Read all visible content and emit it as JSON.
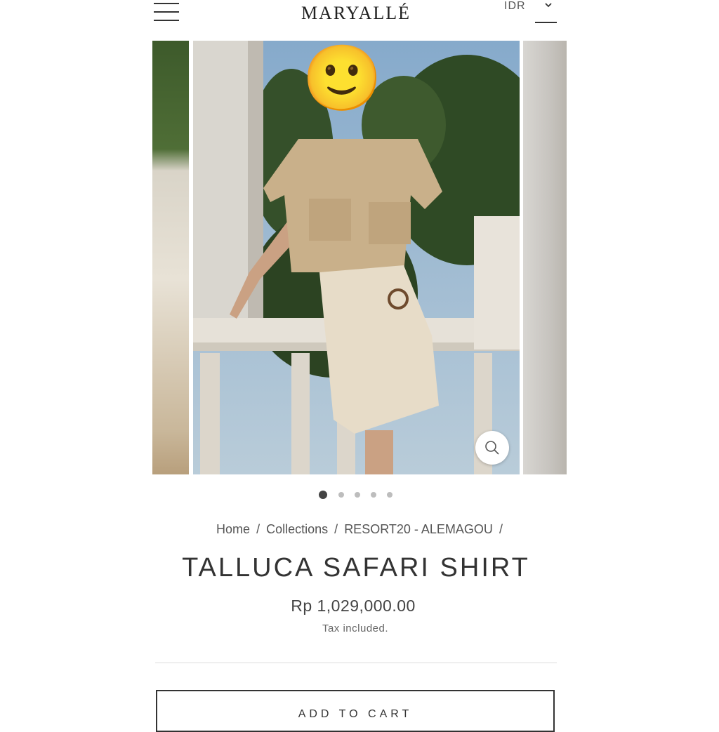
{
  "header": {
    "menu_icon": "hamburger-menu-icon",
    "logo_text": "MARYALLÉ",
    "currency": "IDR",
    "currency_icon": "chevron-down-icon"
  },
  "gallery": {
    "slide_count": 5,
    "active_slide": 1,
    "zoom_icon": "search-icon",
    "face_emoji": "🙂"
  },
  "breadcrumb": {
    "home": "Home",
    "sep1": "/",
    "collections": "Collections",
    "sep2": "/",
    "collection": "RESORT20 - ALEMAGOU",
    "sep3": "/"
  },
  "product": {
    "title": "TALLUCA SAFARI SHIRT",
    "price": "Rp 1,029,000.00",
    "tax_note": "Tax included."
  },
  "actions": {
    "add_to_cart": "ADD TO CART"
  },
  "colors": {
    "text": "#333333",
    "dot_active": "#444444",
    "dot_inactive": "#bdbdbd"
  }
}
